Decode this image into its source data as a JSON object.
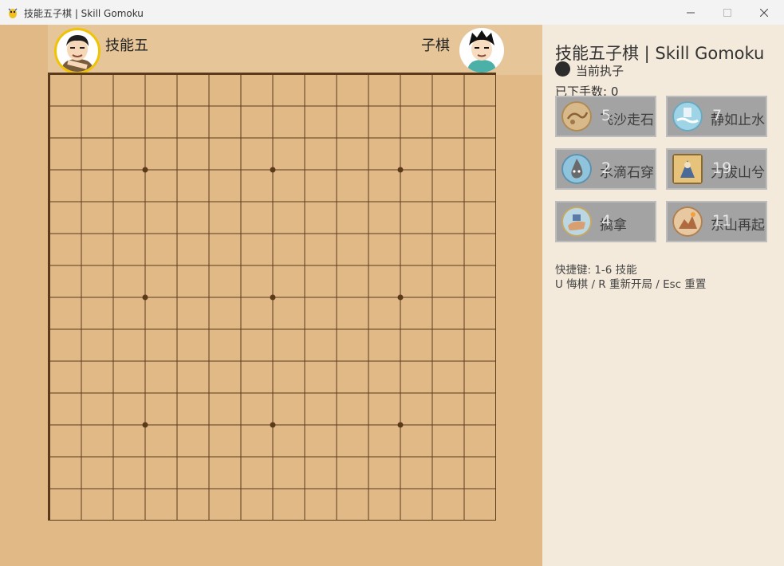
{
  "window": {
    "title": "技能五子棋 | Skill Gomoku",
    "app_icon": "pygame-snake-icon",
    "controls": [
      "minimize-icon",
      "maximize-icon",
      "close-icon"
    ]
  },
  "players": {
    "left_name": "技能五",
    "right_name": "子棋"
  },
  "board": {
    "lines": 15,
    "star_points": [
      [
        3,
        3
      ],
      [
        3,
        7
      ],
      [
        3,
        11
      ],
      [
        7,
        3
      ],
      [
        7,
        7
      ],
      [
        7,
        11
      ],
      [
        11,
        3
      ],
      [
        11,
        7
      ],
      [
        11,
        11
      ]
    ],
    "stones": []
  },
  "panel": {
    "title": "技能五子棋 | Skill Gomoku",
    "turn_label": "当前执子",
    "moves_label": "已下手数: 0",
    "skills": [
      {
        "name": "飞沙走石",
        "count": "5",
        "icon": "sandstorm-icon"
      },
      {
        "name": "静如止水",
        "count": "7",
        "icon": "still-water-icon"
      },
      {
        "name": "水滴石穿",
        "count": "2",
        "icon": "water-drop-icon"
      },
      {
        "name": "力拔山兮",
        "count": "19",
        "icon": "mountain-lift-icon"
      },
      {
        "name": "擒拿",
        "count": "4",
        "icon": "grapple-icon"
      },
      {
        "name": "东山再起",
        "count": "11",
        "icon": "comeback-icon"
      }
    ],
    "hint_line1": "快捷键: 1-6 技能",
    "hint_line2": "U 悔棋 / R 重新开局 / Esc 重置"
  },
  "colors": {
    "board": "#e0b987",
    "grid": "#5a3a1a",
    "panel": "#f4eadb",
    "skill_button": "#a3a3a3"
  }
}
